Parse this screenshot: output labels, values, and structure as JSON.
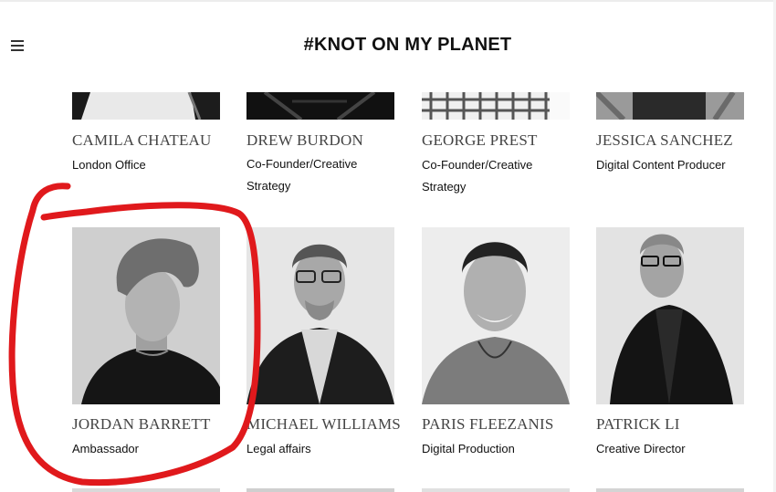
{
  "header": {
    "logo": "#KNOT ON MY PLANET",
    "menu_icon": "hamburger-icon"
  },
  "team": [
    {
      "name": "CAMILA CHATEAU",
      "role": "London Office"
    },
    {
      "name": "DREW BURDON",
      "role": "Co-Founder/Creative Strategy"
    },
    {
      "name": "GEORGE PREST",
      "role": "Co-Founder/Creative Strategy"
    },
    {
      "name": "JESSICA SANCHEZ",
      "role": "Digital Content Producer"
    },
    {
      "name": "JORDAN BARRETT",
      "role": "Ambassador"
    },
    {
      "name": "MICHAEL WILLIAMS",
      "role": "Legal affairs"
    },
    {
      "name": "PARIS FLEEZANIS",
      "role": "Digital Production"
    },
    {
      "name": "PATRICK LI",
      "role": "Creative Director"
    }
  ],
  "annotation": {
    "color": "#e0191c"
  }
}
